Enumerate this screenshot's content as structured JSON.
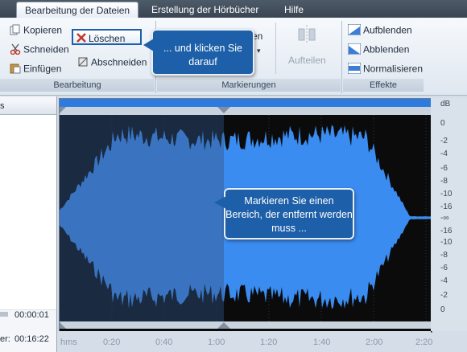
{
  "tabs": [
    {
      "label": "Bearbeitung der Dateien",
      "active": true
    },
    {
      "label": "Erstellung der Hörbücher",
      "active": false
    },
    {
      "label": "Hilfe",
      "active": false
    }
  ],
  "ribbon": {
    "editing": {
      "label": "Bearbeitung",
      "copy": "Kopieren",
      "cut": "Schneiden",
      "paste": "Einfügen",
      "delete": "Löschen",
      "trim": "Abschneiden"
    },
    "markers": {
      "label": "Markierungen",
      "partial_label": "en",
      "split": "Aufteilen"
    },
    "effects": {
      "label": "Effekte",
      "fade_in": "Aufblenden",
      "fade_out": "Abblenden",
      "normalize": "Normalisieren"
    }
  },
  "left_panel": {
    "header": "s",
    "row1_value": "00:00:01",
    "row2_label": "er:",
    "row2_value": "00:16:22"
  },
  "db_scale": {
    "header": "dB",
    "ticks": [
      "0",
      "-2",
      "-4",
      "-6",
      "-8",
      "-10",
      "-16",
      "-∞",
      "-16",
      "-10",
      "-8",
      "-6",
      "-4",
      "-2",
      "0"
    ]
  },
  "time_axis": {
    "labels": [
      "hms",
      "0:20",
      "0:40",
      "1:00",
      "1:20",
      "1:40",
      "2:00",
      "2:20"
    ]
  },
  "callouts": {
    "click": "... und klicken Sie darauf",
    "select": "Markieren Sie einen Bereich, der entfernt werden muss ..."
  },
  "colors": {
    "wave_selected": "#3b8cf0",
    "wave_unselected": "#3a73c0",
    "background": "#0b0b0b",
    "callout": "#1d5fa8"
  }
}
